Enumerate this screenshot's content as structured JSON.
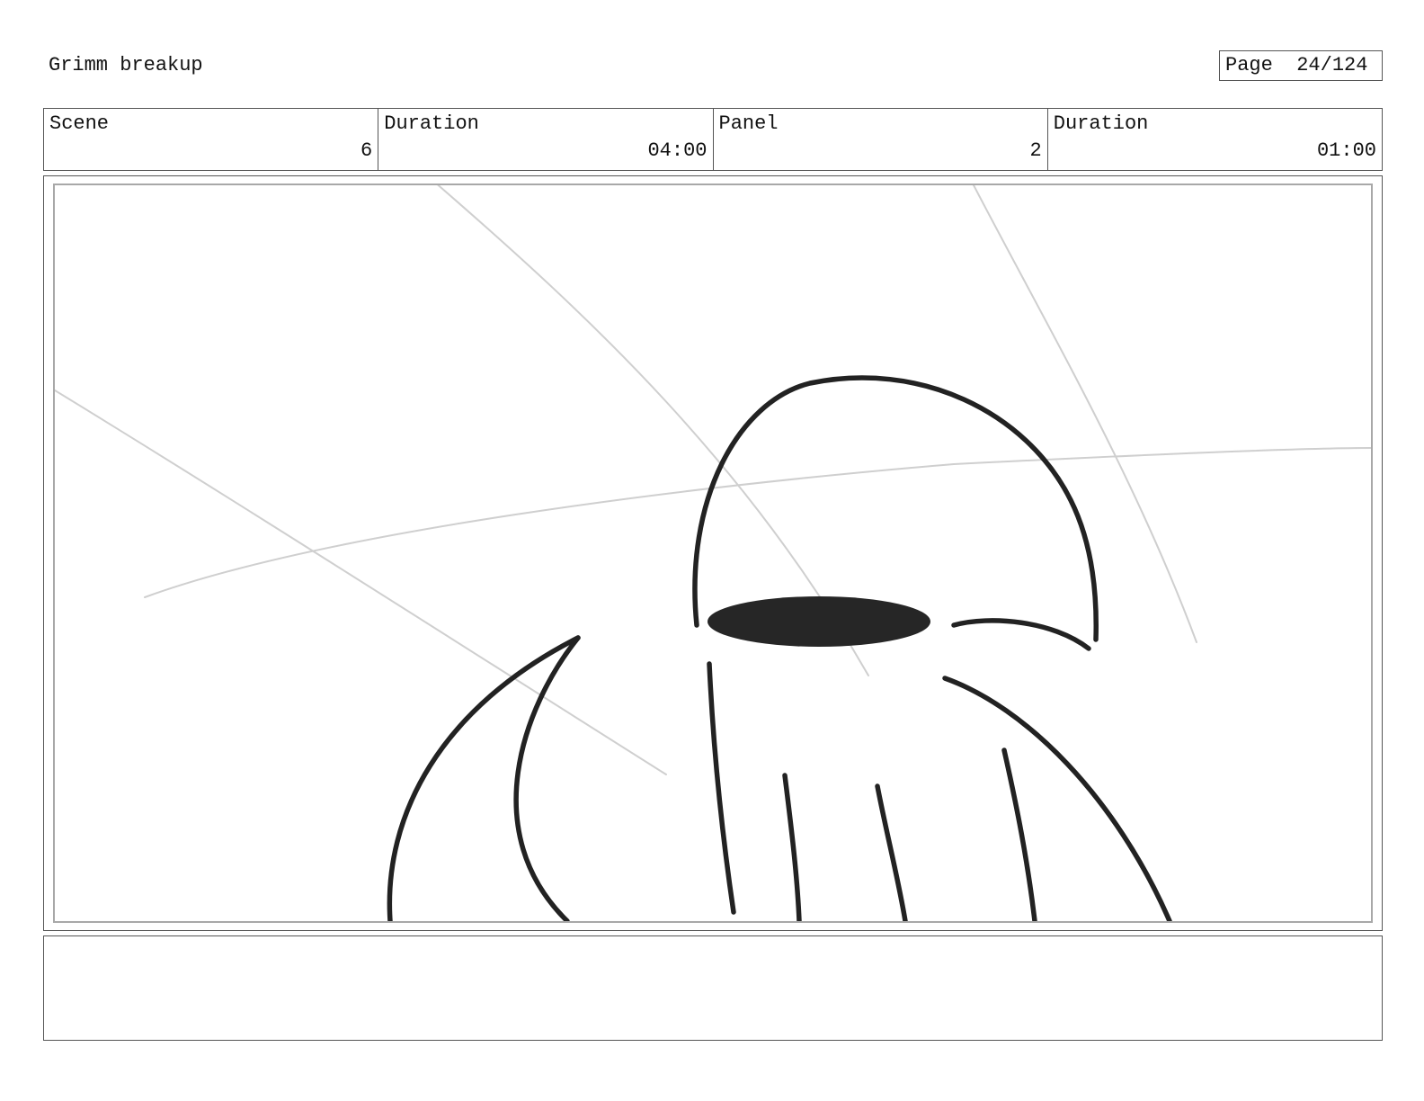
{
  "header": {
    "title": "Grimm breakup",
    "page_label": "Page",
    "page_value": "24/124"
  },
  "info": [
    {
      "label": "Scene",
      "value": "6"
    },
    {
      "label": "Duration",
      "value": "04:00"
    },
    {
      "label": "Panel",
      "value": "2"
    },
    {
      "label": "Duration",
      "value": "01:00"
    }
  ],
  "notes": {
    "text": ""
  },
  "colors": {
    "ink": "#222222",
    "guide_lines": "#cfcfcf",
    "frame": "#a8a8a8"
  }
}
